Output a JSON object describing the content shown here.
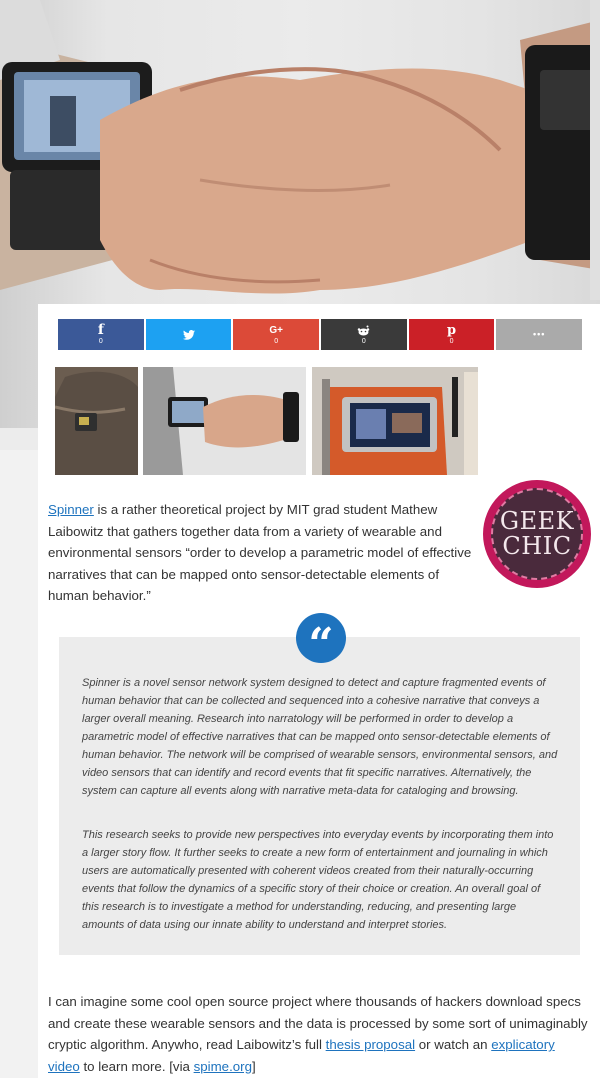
{
  "colors": {
    "facebook": "#3b5998",
    "twitter": "#1da1f2",
    "googleplus": "#dc4a38",
    "reddit": "#3a3a3a",
    "pinterest": "#cb2027",
    "more": "#aaaaaa",
    "link": "#1e73be",
    "logo_ring": "#c2185b"
  },
  "share": [
    {
      "id": "facebook",
      "icon": "f",
      "count": "0"
    },
    {
      "id": "twitter",
      "icon": "twitter-bird",
      "count": "0"
    },
    {
      "id": "googleplus",
      "icon": "G+",
      "count": "0"
    },
    {
      "id": "reddit",
      "icon": "reddit-alien",
      "count": "0"
    },
    {
      "id": "pinterest",
      "icon": "p",
      "count": "0"
    },
    {
      "id": "more",
      "icon": "•••",
      "count": ""
    }
  ],
  "logo": {
    "line1": "GEEK",
    "line2": "CHIC"
  },
  "intro": {
    "link": "Spinner",
    "text": " is a rather theoretical project by MIT grad student Mathew Laibowitz that gathers together data from a variety of wearable and environmental sensors “order to develop a parametric model of effective narratives that can be mapped onto sensor-detectable elements of human behavior.”"
  },
  "quote": {
    "p1": "Spinner is a novel sensor network system designed to detect and capture fragmented events of human behavior that can be collected and sequenced into a cohesive narrative that conveys a larger overall meaning. Research into narratology will be performed in order to develop a parametric model of effective narratives that can be mapped onto sensor-detectable elements of human behavior. The network will be comprised of wearable sensors, environmental sensors, and video sensors that can identify and record events that fit specific narratives. Alternatively, the system can capture all events along with narrative meta-data for cataloging and browsing.",
    "p2": "This research seeks to provide new perspectives into everyday events by incorporating them into a larger story flow. It further seeks to create a new form of entertainment and journaling in which users are automatically presented with coherent videos created from their naturally-occurring events that follow the dynamics of a specific story of their choice or creation. An overall goal of this research is to investigate a method for understanding, reducing, and presenting large amounts of data using our innate ability to understand and interpret stories."
  },
  "outro": {
    "t1": "I can imagine some cool open source project where thousands of hackers download specs and create these wearable sensors and the data is processed by some sort of unimaginably cryptic algorithm. Anywho, read Laibowitz’s full ",
    "link1": "thesis proposal",
    "t2": " or watch an ",
    "link2": "explicatory video",
    "t3": " to learn more. [via ",
    "link3": "spime.org",
    "t4": "]"
  }
}
